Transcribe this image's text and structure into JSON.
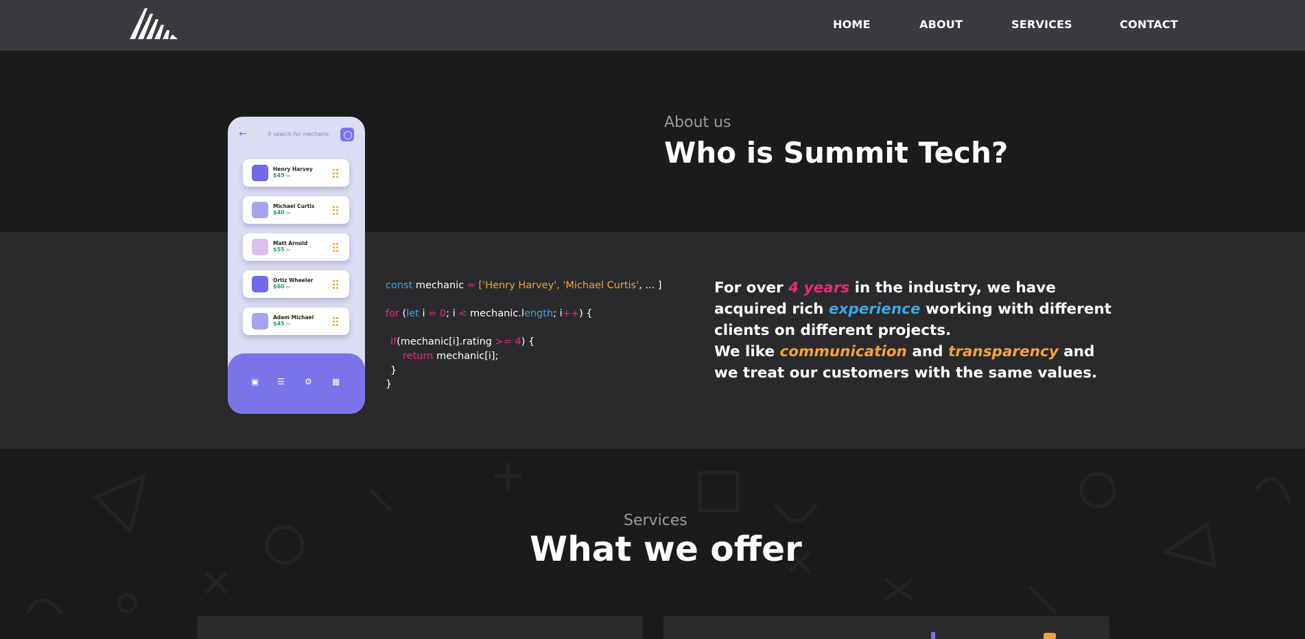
{
  "nav": {
    "logo": "summit-tech-logo",
    "links": [
      "HOME",
      "ABOUT",
      "SERVICES",
      "CONTACT"
    ]
  },
  "about": {
    "eyebrow": "About us",
    "title": "Who is Summit Tech?"
  },
  "phone": {
    "search_placeholder": "search for mechanic",
    "mechanics": [
      {
        "name": "Henry Harvey",
        "price": "$45",
        "unit": "/hr",
        "color": "#6f6ae8"
      },
      {
        "name": "Michael Curtis",
        "price": "$40",
        "unit": "/hr",
        "color": "#a6a3ee"
      },
      {
        "name": "Matt Arnold",
        "price": "$55",
        "unit": "/hr",
        "color": "#d9c2ef"
      },
      {
        "name": "Ortiz Wheeler",
        "price": "$60",
        "unit": "/hr",
        "color": "#6f6ae8"
      },
      {
        "name": "Adam Michael",
        "price": "$45",
        "unit": "/hr",
        "color": "#a6a3ee"
      }
    ],
    "bottom_icons": [
      "briefcase-icon",
      "cart-icon",
      "gear-icon",
      "grid-icon"
    ]
  },
  "code": {
    "l1_kw": "const",
    "l1_var": " mechanic ",
    "l1_eq": "=",
    "l1_br": " [",
    "l1_s1": "'Henry Harvey'",
    "l1_c1": ", ",
    "l1_s2": "'Michael Curtis'",
    "l1_rest": ", ... ]",
    "l2_for": "for",
    "l2_p": " (",
    "l2_let": "let",
    "l2_i": " i ",
    "l2_eq": "=",
    "l2_zero": " 0",
    "l2_semi": "; i ",
    "l2_lt": "<",
    "l2_mech": " mechanic.l",
    "l2_len": "ength",
    "l2_semi2": "; i",
    "l2_pp": "++",
    "l2_end": ") {",
    "l3_if": "if",
    "l3_mid": "(mechanic[i].rating ",
    "l3_ge": ">=",
    "l3_four": " 4",
    "l3_end": ") {",
    "l4_ret": "return",
    "l4_rest": " mechanic[i];",
    "l5": "}",
    "l6": "}"
  },
  "paragraph": {
    "p1": "For over ",
    "years": "4 years",
    "p2": " in the industry, we have",
    "p3": "acquired rich ",
    "experience": "experience",
    "p4": " working with different",
    "p5": "clients on different projects.",
    "p6": "We like ",
    "communication": "communication",
    "p7": " and ",
    "transparency": "transparency",
    "p8": " and",
    "p9": "we treat our customers with the same values."
  },
  "services": {
    "eyebrow": "Services",
    "title": "What we offer"
  },
  "colors": {
    "accent_pink": "#e8297a",
    "accent_blue": "#3aa9e6",
    "accent_orange": "#f2a33c",
    "phone_purple": "#7b74e8"
  }
}
